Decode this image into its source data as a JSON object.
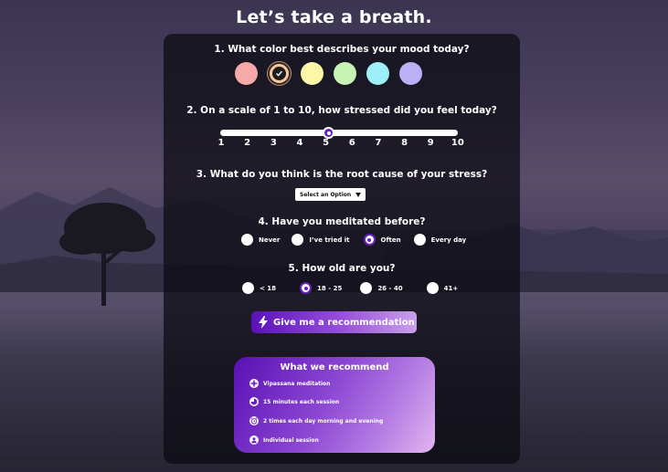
{
  "page": {
    "title": "Let’s take a breath."
  },
  "q1": {
    "label": "1. What color best describes your mood today?",
    "options": [
      {
        "color": "#f7a8a8",
        "selected": false
      },
      {
        "color": "#f8c79b",
        "selected": true
      },
      {
        "color": "#fbf7a6",
        "selected": false
      },
      {
        "color": "#c7f4b2",
        "selected": false
      },
      {
        "color": "#9ef0f8",
        "selected": false
      },
      {
        "color": "#b9b0f5",
        "selected": false
      }
    ]
  },
  "q2": {
    "label": "2. On a scale of 1 to 10, how stressed did you feel today?",
    "ticks": [
      "1",
      "2",
      "3",
      "4",
      "5",
      "6",
      "7",
      "8",
      "9",
      "10"
    ],
    "value": 5
  },
  "q3": {
    "label": "3. What do you think is the root cause of your stress?",
    "select_value": "Select an Option"
  },
  "q4": {
    "label": "4. Have you meditated before?",
    "options": [
      "Never",
      "I’ve tried it",
      "Often",
      "Every day"
    ],
    "selected": "Often"
  },
  "q5": {
    "label": "5. How old are you?",
    "options": [
      "< 18",
      "18 - 25",
      "26 - 40",
      "41+"
    ],
    "selected": "18 - 25"
  },
  "cta": {
    "label": "Give me a recommendation"
  },
  "recommendation": {
    "title": "What we recommend",
    "items": [
      {
        "icon": "lotus-icon",
        "text": "Vipassana meditation"
      },
      {
        "icon": "clock-pie-icon",
        "text": "15 minutes each session"
      },
      {
        "icon": "alarm-clock-icon",
        "text": "2 times each day morning and evening"
      },
      {
        "icon": "person-icon",
        "text": "Individual session"
      }
    ]
  },
  "colors": {
    "accent": "#6a1fc2"
  }
}
